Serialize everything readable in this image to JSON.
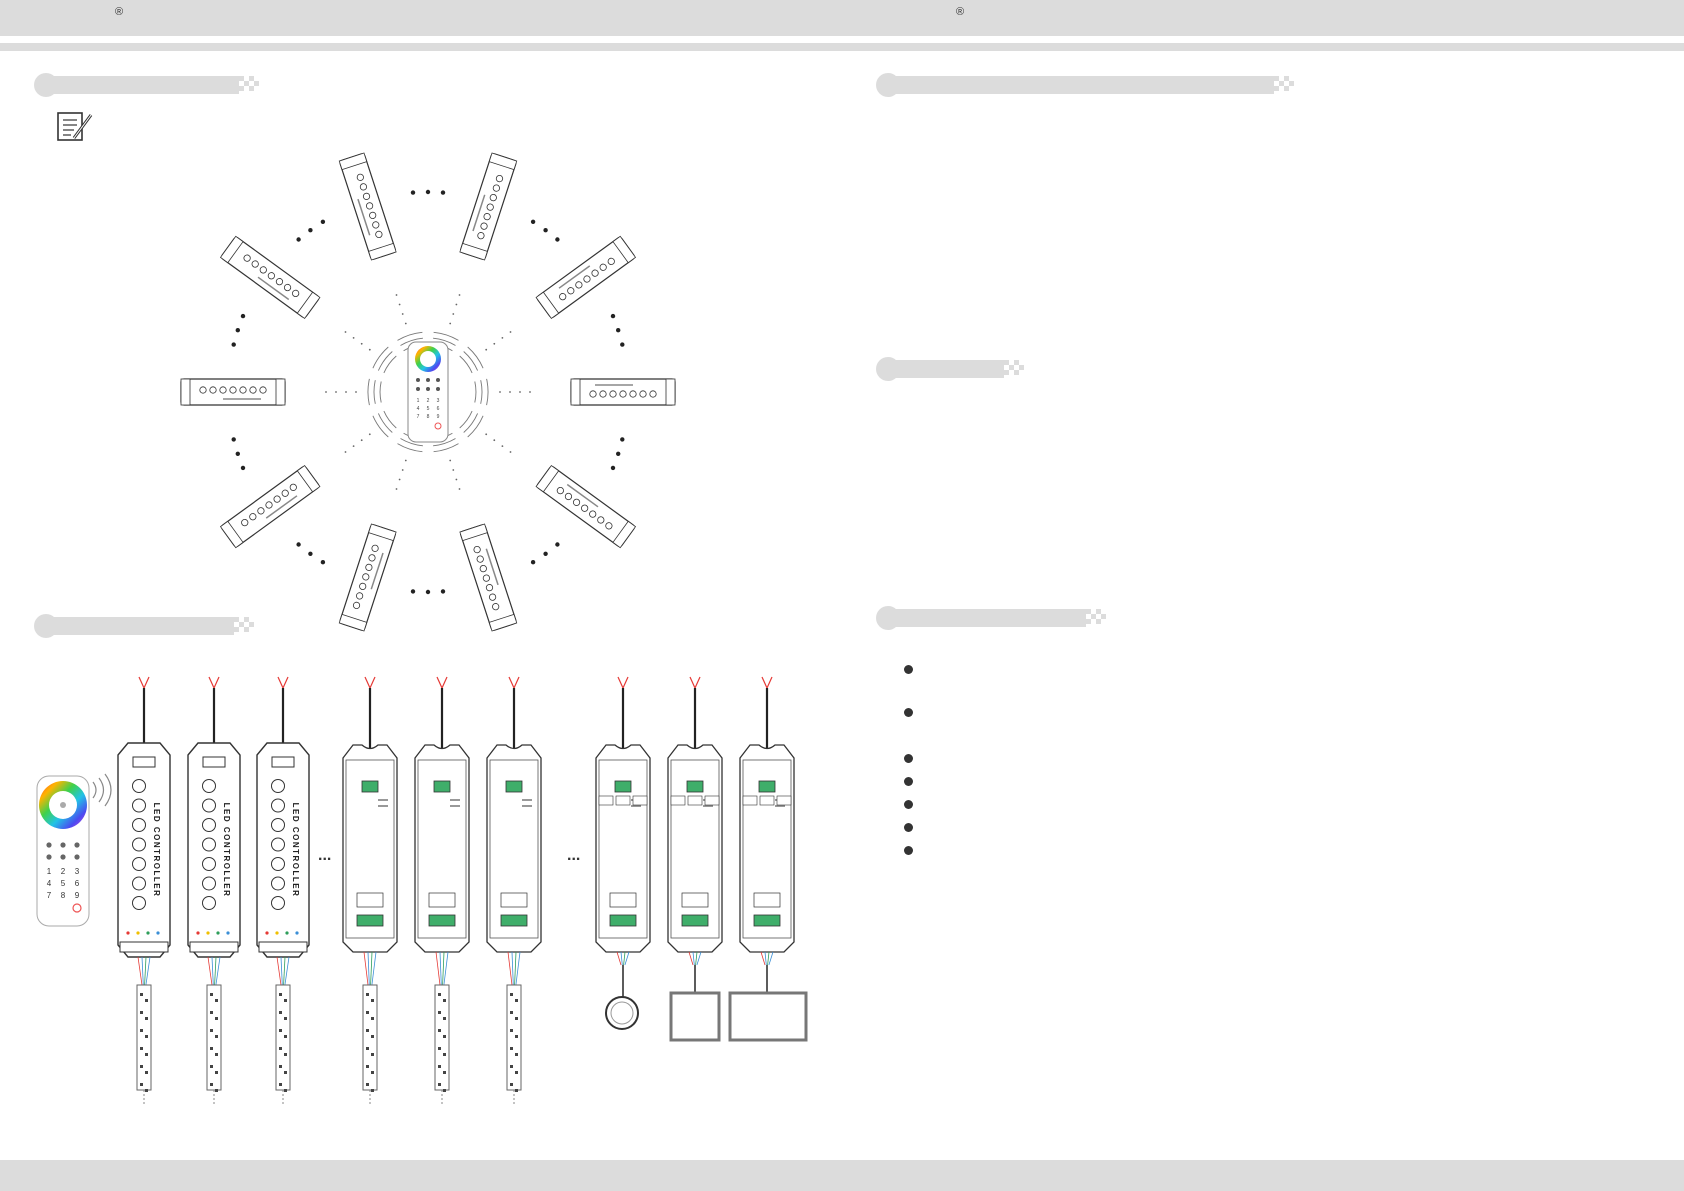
{
  "header": {
    "reg_mark_left": "®",
    "reg_mark_right": "®"
  },
  "icons": {
    "note": "notepad-pencil-icon",
    "remote_on_air": "wireless-signal-icon"
  },
  "diagram_top": {
    "remote_keypad": [
      "1",
      "2",
      "3",
      "4",
      "5",
      "6",
      "7",
      "8",
      "9"
    ]
  },
  "diagram_bottom": {
    "controller_label": "LED CONTROLLER",
    "remote_keypad": [
      "1",
      "2",
      "3",
      "4",
      "5",
      "6",
      "7",
      "8",
      "9"
    ],
    "ellipsis": "..."
  },
  "colors": {
    "bar": "#dcdcdc",
    "line": "#333333",
    "wire_red": "#e53935",
    "wire_blue": "#3b8fd6",
    "wire_green": "#2e9e5b"
  }
}
